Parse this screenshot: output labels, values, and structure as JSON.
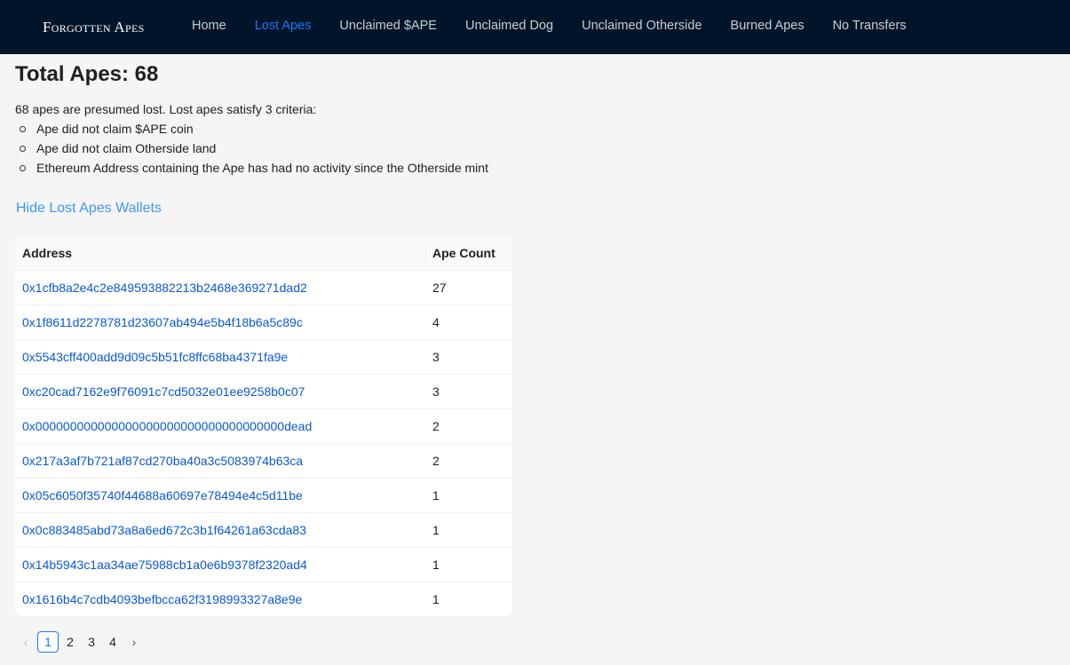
{
  "header": {
    "brand": "Forgotten Apes",
    "nav": [
      {
        "label": "Home",
        "active": false
      },
      {
        "label": "Lost Apes",
        "active": true
      },
      {
        "label": "Unclaimed $APE",
        "active": false
      },
      {
        "label": "Unclaimed Dog",
        "active": false
      },
      {
        "label": "Unclaimed Otherside",
        "active": false
      },
      {
        "label": "Burned Apes",
        "active": false
      },
      {
        "label": "No Transfers",
        "active": false
      }
    ]
  },
  "main": {
    "title": "Total Apes: 68",
    "intro": "68 apes are presumed lost. Lost apes satisfy 3 criteria:",
    "criteria": [
      "Ape did not claim $APE coin",
      "Ape did not claim Otherside land",
      "Ethereum Address containing the Ape has had no activity since the Otherside mint"
    ],
    "toggle_label": "Hide Lost Apes Wallets"
  },
  "table": {
    "columns": [
      "Address",
      "Ape Count"
    ],
    "rows": [
      {
        "address": "0x1cfb8a2e4c2e849593882213b2468e369271dad2",
        "count": "27"
      },
      {
        "address": "0x1f8611d2278781d23607ab494e5b4f18b6a5c89c",
        "count": "4"
      },
      {
        "address": "0x5543cff400add9d09c5b51fc8ffc68ba4371fa9e",
        "count": "3"
      },
      {
        "address": "0xc20cad7162e9f76091c7cd5032e01ee9258b0c07",
        "count": "3"
      },
      {
        "address": "0x000000000000000000000000000000000000dead",
        "count": "2"
      },
      {
        "address": "0x217a3af7b721af87cd270ba40a3c5083974b63ca",
        "count": "2"
      },
      {
        "address": "0x05c6050f35740f44688a60697e78494e4c5d11be",
        "count": "1"
      },
      {
        "address": "0x0c883485abd73a8a6ed672c3b1f64261a63cda83",
        "count": "1"
      },
      {
        "address": "0x14b5943c1aa34ae75988cb1a0e6b9378f2320ad4",
        "count": "1"
      },
      {
        "address": "0x1616b4c7cdb4093befbcca62f3198993327a8e9e",
        "count": "1"
      }
    ]
  },
  "pagination": {
    "prev": "‹",
    "next": "›",
    "pages": [
      "1",
      "2",
      "3",
      "4"
    ],
    "current": "1"
  },
  "colors": {
    "header_bg": "#001529",
    "accent": "#1677ff",
    "link": "#0958d9"
  }
}
